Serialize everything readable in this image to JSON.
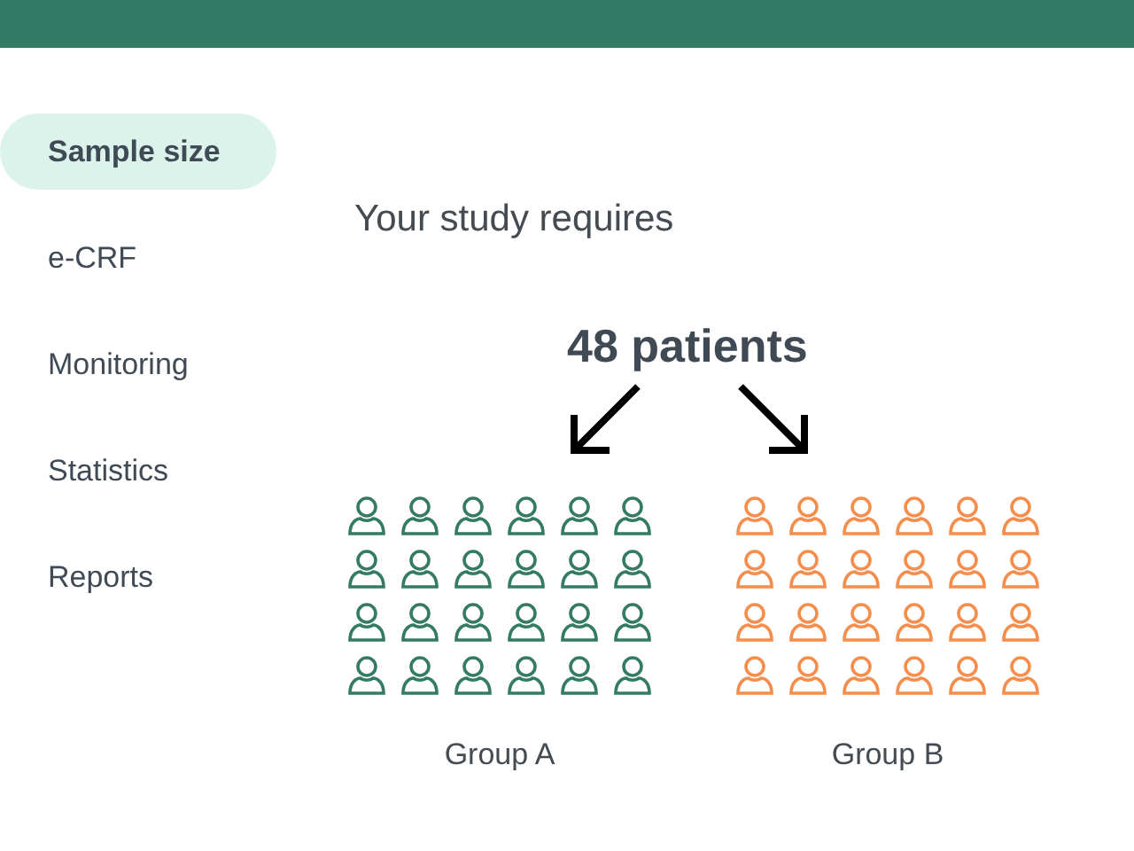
{
  "sidebar": {
    "items": [
      {
        "label": "Sample size",
        "selected": true
      },
      {
        "label": "e-CRF",
        "selected": false
      },
      {
        "label": "Monitoring",
        "selected": false
      },
      {
        "label": "Statistics",
        "selected": false
      },
      {
        "label": "Reports",
        "selected": false
      }
    ]
  },
  "main": {
    "intro": "Your study requires",
    "total": "48 patients",
    "groups": [
      {
        "label": "Group A",
        "color": "#357a64"
      },
      {
        "label": "Group B",
        "color": "#f58d4c"
      }
    ]
  }
}
